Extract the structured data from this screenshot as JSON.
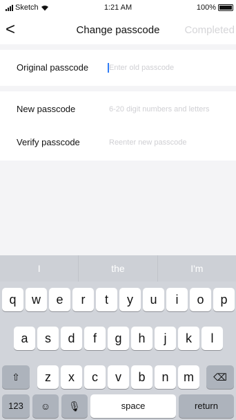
{
  "status_bar": {
    "carrier": "Sketch",
    "time": "1:21 AM",
    "battery": "100%"
  },
  "nav": {
    "back_icon": "chevron-left-icon",
    "back_glyph": "<",
    "title": "Change passcode",
    "completed": "Completed"
  },
  "form": {
    "original": {
      "label": "Original passcode",
      "placeholder": "Enter old passcode"
    },
    "new": {
      "label": "New passcode",
      "placeholder": "6-20 digit numbers and letters"
    },
    "verify": {
      "label": "Verify passcode",
      "placeholder": "Reenter new passcode"
    }
  },
  "keyboard": {
    "suggestions": [
      "I",
      "the",
      "I'm"
    ],
    "row1": [
      "q",
      "w",
      "e",
      "r",
      "t",
      "y",
      "u",
      "i",
      "o",
      "p"
    ],
    "row2": [
      "a",
      "s",
      "d",
      "f",
      "g",
      "h",
      "j",
      "k",
      "l"
    ],
    "row3": [
      "z",
      "x",
      "c",
      "v",
      "b",
      "n",
      "m"
    ],
    "shift_icon": "shift-icon",
    "shift_glyph": "⇧",
    "backspace_icon": "backspace-icon",
    "backspace_glyph": "⌫",
    "numbers_label": "123",
    "emoji_icon": "emoji-icon",
    "emoji_glyph": "☺",
    "mic_icon": "microphone-icon",
    "mic_glyph": "🎙",
    "space_label": "space",
    "return_label": "return"
  }
}
